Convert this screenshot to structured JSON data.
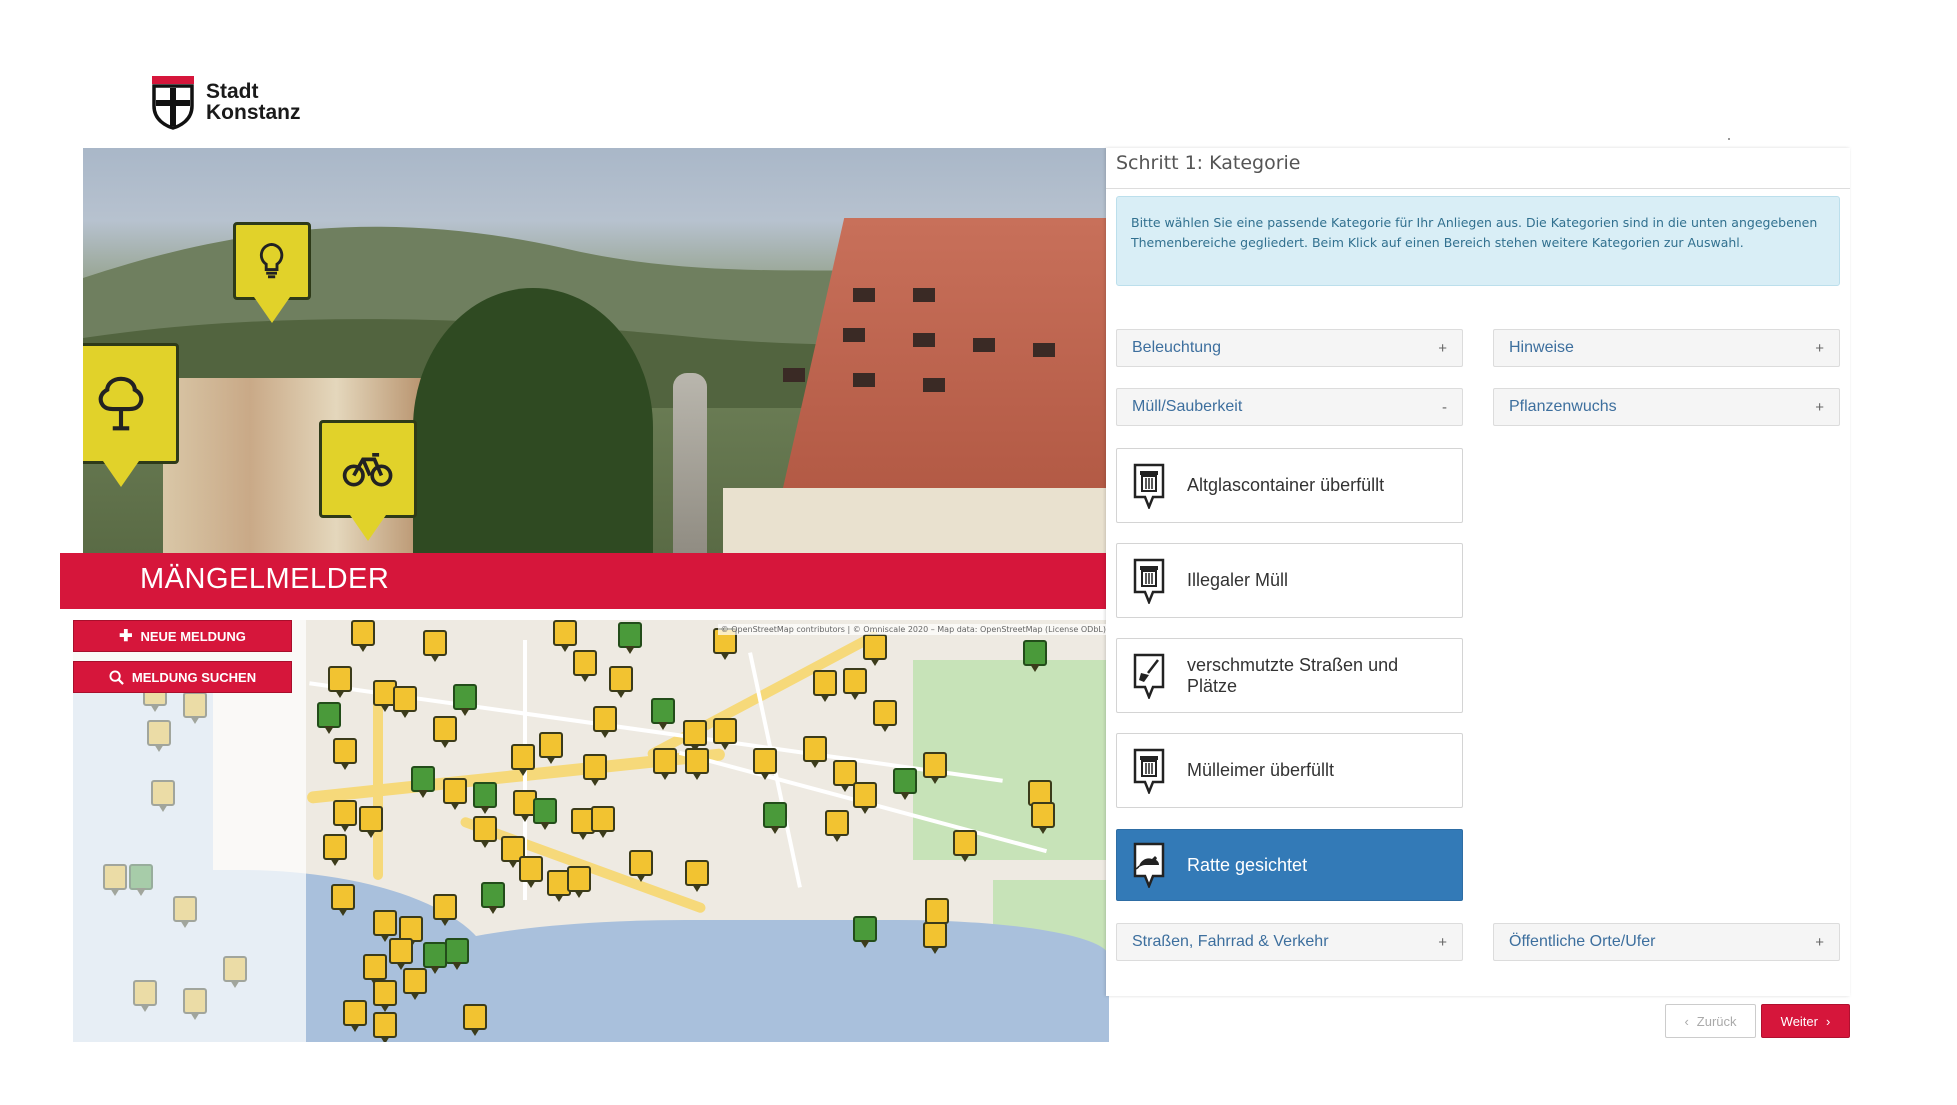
{
  "logo": {
    "line1": "Stadt",
    "line2": "Konstanz"
  },
  "banner": {
    "title": "MÄNGELMELDER"
  },
  "map": {
    "new_report": "NEUE MELDUNG",
    "search_report": "MELDUNG SUCHEN",
    "attribution": "© OpenStreetMap contributors | © Omniscale 2020 – Map data: OpenStreetMap (License ODbL)"
  },
  "panel": {
    "step_title": "Schritt 1: Kategorie",
    "info": "Bitte wählen Sie eine passende Kategorie für Ihr Anliegen aus. Die Kategorien sind in die unten angegebenen Themenbereiche gegliedert. Beim Klick auf einen Bereich stehen weitere Kategorien zur Auswahl.",
    "categories": [
      {
        "label": "Beleuchtung",
        "sign": "+"
      },
      {
        "label": "Hinweise",
        "sign": "+"
      },
      {
        "label": "Müll/Sauberkeit",
        "sign": "-"
      },
      {
        "label": "Pflanzenwuchs",
        "sign": "+"
      },
      {
        "label": "Straßen, Fahrrad & Verkehr",
        "sign": "+"
      },
      {
        "label": "Öffentliche Orte/Ufer",
        "sign": "+"
      }
    ],
    "subcategories": [
      {
        "label": "Altglascontainer überfüllt",
        "icon": "trash-bin-icon"
      },
      {
        "label": "Illegaler Müll",
        "icon": "trash-bin-icon"
      },
      {
        "label": "verschmutzte Straßen und Plätze",
        "icon": "broom-icon"
      },
      {
        "label": "Mülleimer überfüllt",
        "icon": "trash-bin-icon"
      },
      {
        "label": "Ratte gesichtet",
        "icon": "rat-icon",
        "selected": true
      }
    ]
  },
  "footer": {
    "back": "Zurück",
    "next": "Weiter"
  },
  "colors": {
    "brand_red": "#d6163b",
    "selected_blue": "#337ab7",
    "info_bg": "#d9eef6",
    "pin_yellow": "#e1d22a"
  }
}
